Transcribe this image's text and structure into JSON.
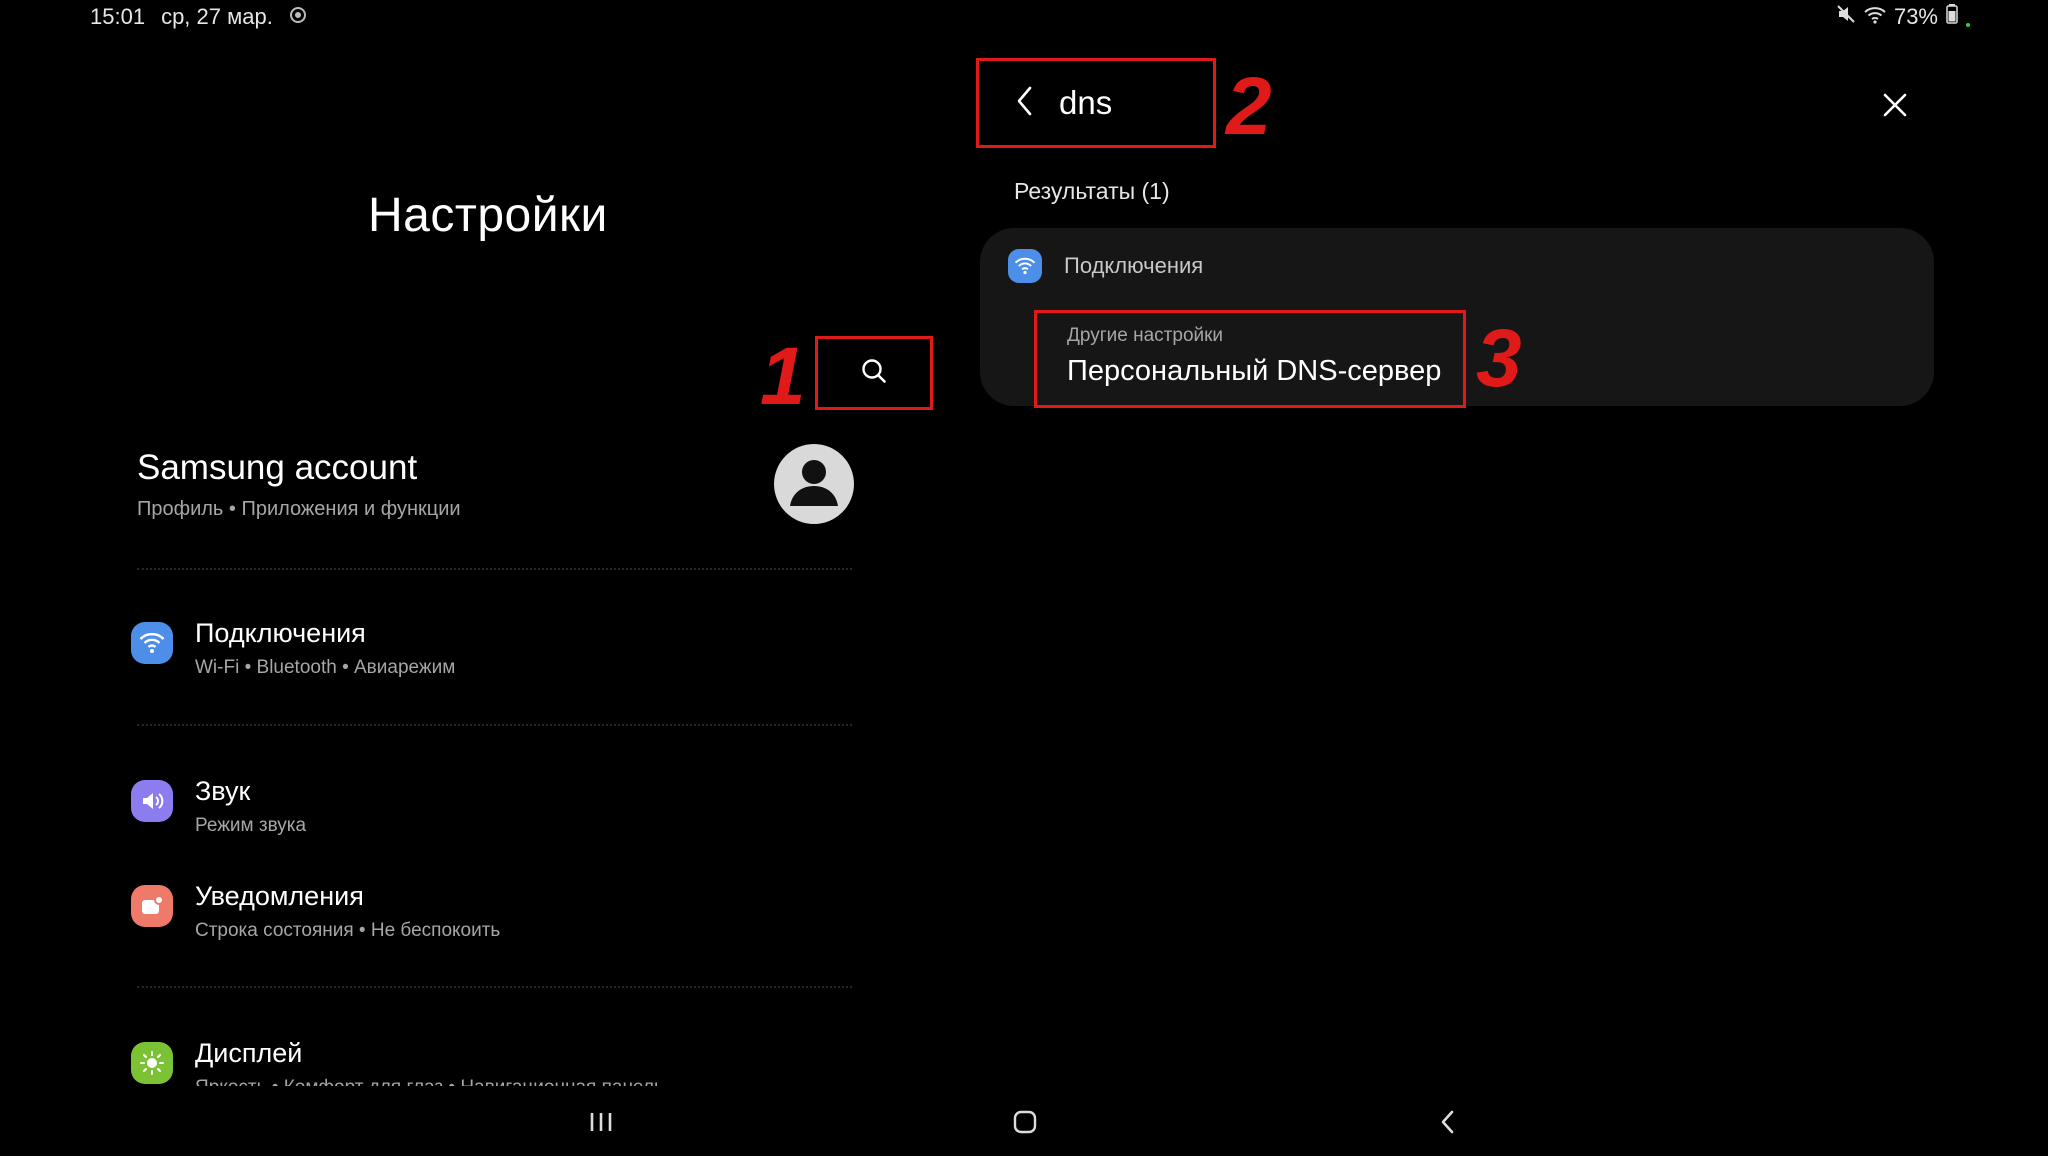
{
  "status_bar": {
    "time": "15:01",
    "date": "ср, 27 мар.",
    "battery": "73%"
  },
  "left_pane": {
    "title": "Настройки",
    "account": {
      "title": "Samsung account",
      "subtitle": "Профиль • Приложения и функции"
    },
    "items": [
      {
        "title": "Подключения",
        "subtitle": "Wi-Fi • Bluetooth • Авиарежим",
        "icon": "wifi-icon",
        "color": "#4d8fe8"
      },
      {
        "title": "Звук",
        "subtitle": "Режим звука",
        "icon": "volume-icon",
        "color": "#8b7cf0"
      },
      {
        "title": "Уведомления",
        "subtitle": "Строка состояния • Не беспокоить",
        "icon": "notification-icon",
        "color": "#f07a6a"
      },
      {
        "title": "Дисплей",
        "subtitle": "Яркость • Комфорт для глаз • Навигационная панель",
        "icon": "sun-icon",
        "color": "#7cc235"
      }
    ]
  },
  "search": {
    "query": "dns",
    "results_label": "Результаты (1)"
  },
  "result_card": {
    "category": "Подключения",
    "item_subtitle": "Другие настройки",
    "item_title": "Персональный DNS-сервер"
  },
  "annotations": {
    "m1": "1",
    "m2": "2",
    "m3": "3",
    "color": "#e01919"
  }
}
